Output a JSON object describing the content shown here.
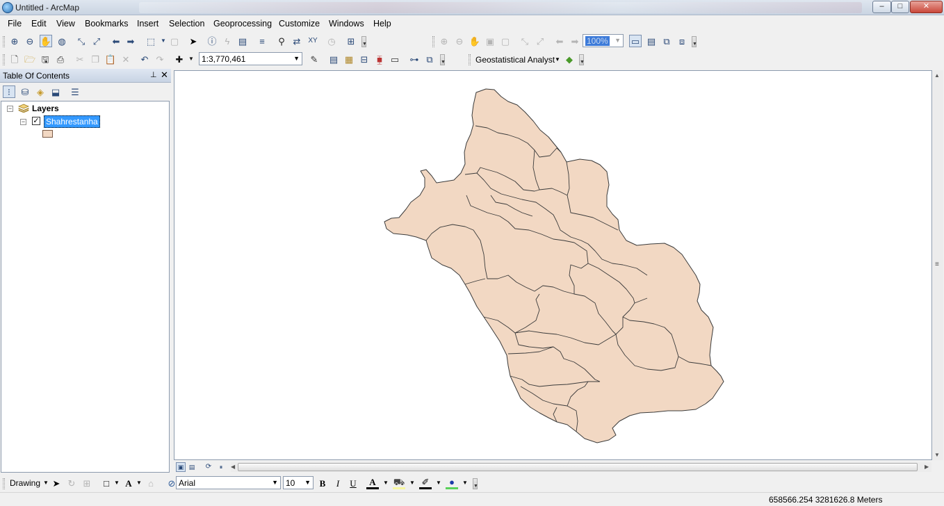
{
  "window": {
    "title": "Untitled - ArcMap",
    "minimize": "–",
    "maximize": "□",
    "close": "✕"
  },
  "menu": [
    "File",
    "Edit",
    "View",
    "Bookmarks",
    "Insert",
    "Selection",
    "Geoprocessing",
    "Customize",
    "Windows",
    "Help"
  ],
  "toolbar": {
    "scale_value": "1:3,770,461",
    "zoom_percent": "100%",
    "geostat_label": "Geostatistical Analyst"
  },
  "toc": {
    "title": "Table Of Contents",
    "pin": "⊥",
    "close": "✕",
    "root": {
      "label": "Layers",
      "expander": "−"
    },
    "layer": {
      "label": "Shahrestanha",
      "checked": "✓",
      "expander": "−"
    },
    "symbol_color": "#f2d8c3"
  },
  "map": {
    "fill_color": "#f2d8c3",
    "outline_color": "#3a3a3a"
  },
  "drawing": {
    "label": "Drawing",
    "font_name": "Arial",
    "font_size": "10",
    "bold": "B",
    "italic": "I",
    "underline": "U",
    "font_color_glyph": "A"
  },
  "status": {
    "coordinates": "658566.254  3281626.8 Meters"
  },
  "colors": {
    "accent": "#3399ff",
    "map_fill": "#f2d8c3"
  }
}
